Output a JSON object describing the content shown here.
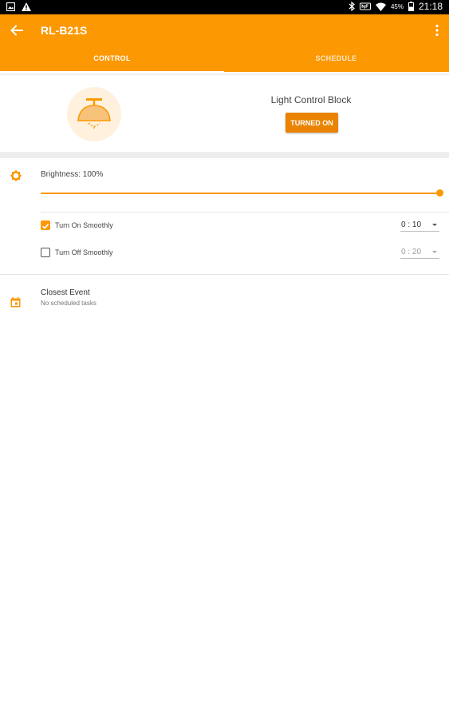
{
  "status_bar": {
    "battery_percent": "45%",
    "time": "21:18",
    "icons": [
      "image-icon",
      "warning-icon",
      "bluetooth-icon",
      "nfc-icon",
      "wifi-icon",
      "battery-icon"
    ]
  },
  "app_bar": {
    "title": "RL-B21S",
    "tabs": [
      {
        "label": "CONTROL",
        "selected": true
      },
      {
        "label": "SCHEDULE",
        "selected": false
      }
    ]
  },
  "device": {
    "name": "Light Control Block",
    "state_button": "TURNED ON"
  },
  "brightness": {
    "label": "Brightness: 100%",
    "level": 1.0
  },
  "smooth": [
    {
      "label": "Turn On Smoothly",
      "checked": true,
      "value": "0 : 10",
      "enabled": true
    },
    {
      "label": "Turn Off Smoothly",
      "checked": false,
      "value": "0 : 20",
      "enabled": false
    }
  ],
  "closest_event": {
    "title": "Closest Event",
    "subtitle": "No scheduled tasks"
  },
  "colors": {
    "accent": "#fb9802",
    "button": "#e98300",
    "lamp_bg": "#fff1de"
  }
}
